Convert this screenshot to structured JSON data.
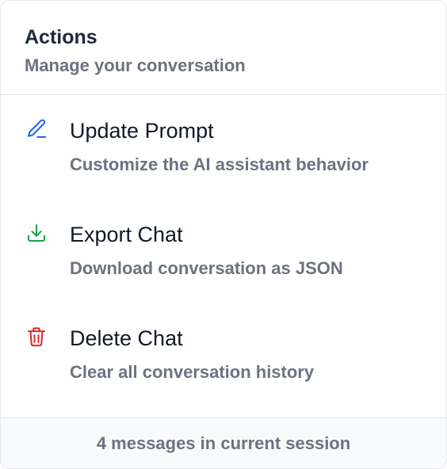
{
  "header": {
    "title": "Actions",
    "subtitle": "Manage your conversation"
  },
  "actions": [
    {
      "label": "Update Prompt",
      "description": "Customize the AI assistant behavior",
      "icon": "pencil-icon",
      "color": "#2563eb"
    },
    {
      "label": "Export Chat",
      "description": "Download conversation as JSON",
      "icon": "download-icon",
      "color": "#16a34a"
    },
    {
      "label": "Delete Chat",
      "description": "Clear all conversation history",
      "icon": "trash-icon",
      "color": "#dc2626"
    }
  ],
  "footer": {
    "status_text": "4 messages in current session"
  },
  "colors": {
    "title": "#1f2937",
    "muted": "#6b7280",
    "border": "#e5e7eb",
    "footer_bg": "#f9fafb"
  }
}
